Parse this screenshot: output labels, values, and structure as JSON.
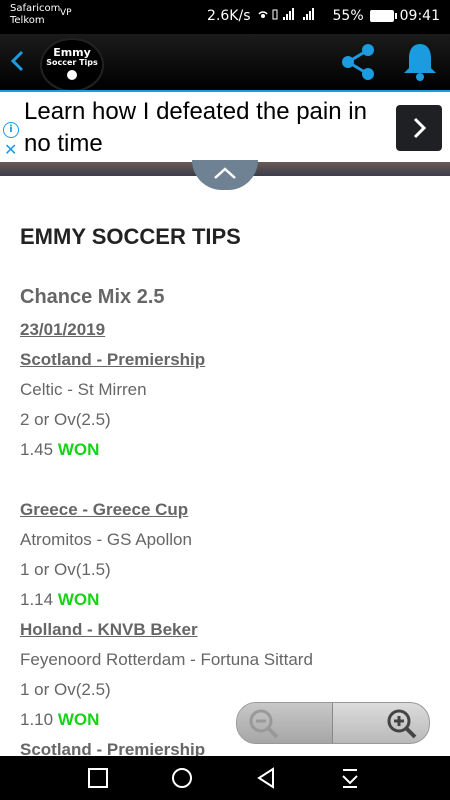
{
  "status_bar": {
    "carrier_line1": "Safaricom",
    "carrier_line2": "Telkom",
    "vp_label": "VP",
    "speed": "2.6K/s",
    "battery": "55%",
    "time": "09:41"
  },
  "app_bar": {
    "logo_line1": "Emmy",
    "logo_line2": "Soccer Tips",
    "accent_color": "#1b9be0"
  },
  "ad": {
    "text": "Learn how I defeated the pain in no time"
  },
  "content": {
    "site_title": "EMMY SOCCER TIPS",
    "section_title": "Chance Mix 2.5",
    "date": "23/01/2019",
    "items": [
      {
        "league": "Scotland - Premiership",
        "match": "Celtic - St Mirren",
        "tip": "2 or Ov(2.5)",
        "odds": "1.45",
        "result": "WON"
      },
      {
        "league": "Greece - Greece Cup",
        "match": "Atromitos - GS Apollon",
        "tip": "1 or Ov(1.5)",
        "odds": "1.14",
        "result": "WON"
      },
      {
        "league": "Holland - KNVB Beker",
        "match": "Feyenoord Rotterdam - Fortuna Sittard",
        "tip": "1 or Ov(2.5)",
        "odds": "1.10",
        "result": "WON"
      },
      {
        "league": "Scotland - Premiership"
      }
    ]
  },
  "icons": {
    "back": "chevron-left-icon",
    "share": "share-icon",
    "bell": "bell-icon",
    "zoom_out": "zoom-out-icon",
    "zoom_in": "zoom-in-icon"
  }
}
